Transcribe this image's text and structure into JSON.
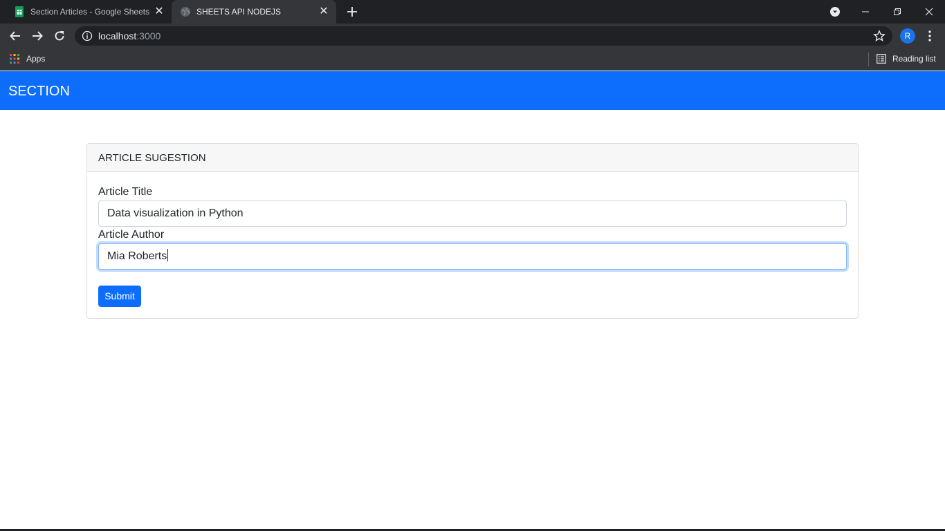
{
  "browser": {
    "tabs": [
      {
        "title": "Section Articles - Google Sheets",
        "active": false,
        "favicon": "google-sheets-icon"
      },
      {
        "title": "SHEETS API NODEJS",
        "active": true,
        "favicon": "globe-icon"
      }
    ],
    "url": {
      "host": "localhost",
      "port": ":3000"
    },
    "avatar_letter": "R",
    "bookmarks": {
      "apps_label": "Apps",
      "reading_list_label": "Reading list"
    }
  },
  "navbar": {
    "brand": "SECTION",
    "color": "#0d6efd"
  },
  "card": {
    "header": "ARTICLE SUGESTION",
    "fields": [
      {
        "label": "Article Title",
        "value": "Data visualization in Python"
      },
      {
        "label": "Article Author",
        "value": "Mia Roberts",
        "focused": true
      }
    ],
    "submit_label": "Submit"
  }
}
